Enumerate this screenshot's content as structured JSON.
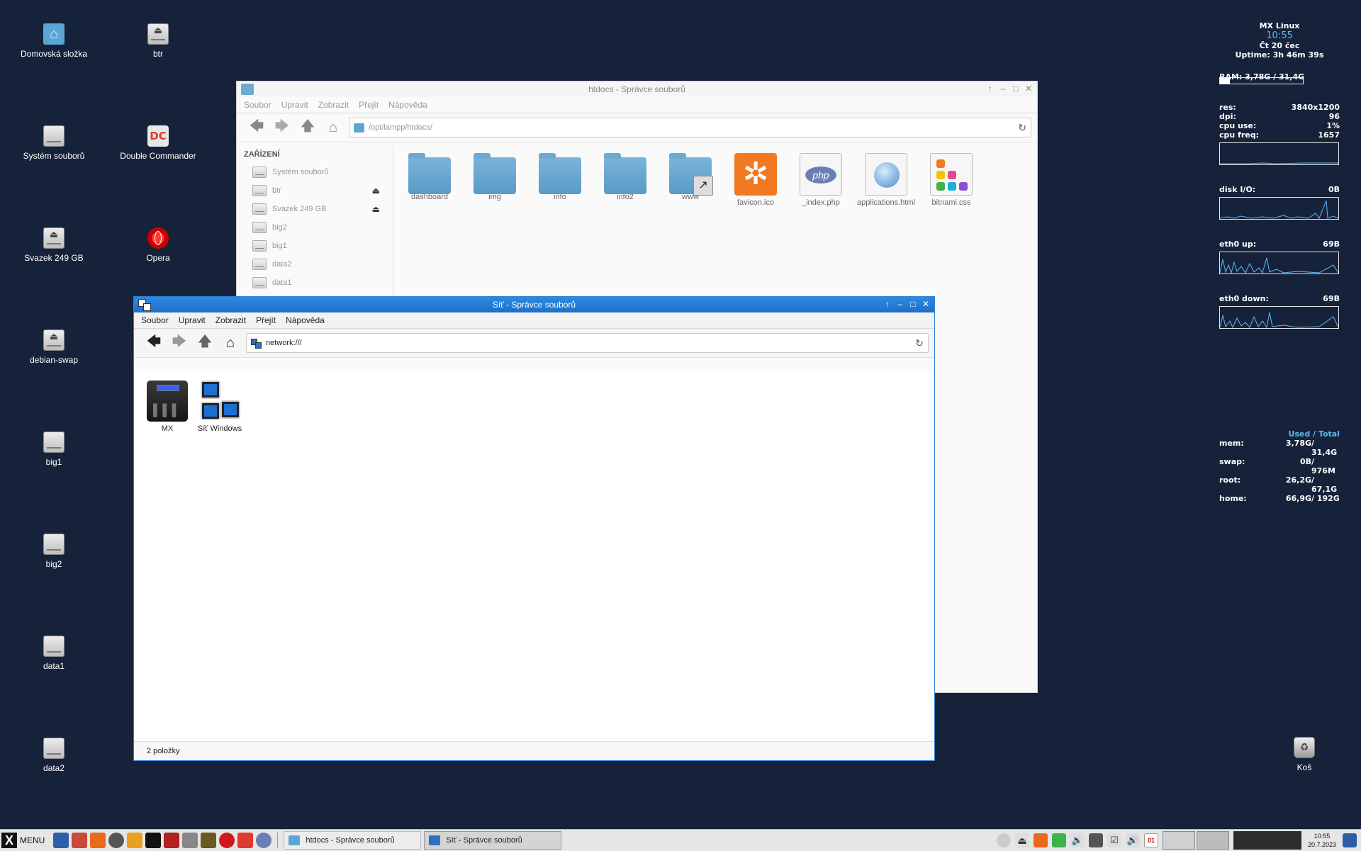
{
  "desktop": {
    "icons": [
      {
        "label": "Domovská složka",
        "kind": "home"
      },
      {
        "label": "btr",
        "kind": "eject"
      },
      {
        "label": "Systém souborů",
        "kind": "drive"
      },
      {
        "label": "Double Commander",
        "kind": "dc"
      },
      {
        "label": "Svazek 249 GB",
        "kind": "eject"
      },
      {
        "label": "Opera",
        "kind": "opera"
      },
      {
        "label": "debian-swap",
        "kind": "drive"
      },
      {
        "label": "big1",
        "kind": "drive"
      },
      {
        "label": "big2",
        "kind": "drive"
      },
      {
        "label": "data1",
        "kind": "drive"
      },
      {
        "label": "data2",
        "kind": "drive"
      },
      {
        "label": "Koš",
        "kind": "trash"
      }
    ]
  },
  "conky": {
    "host": "MX Linux",
    "time": "10:55",
    "date": "Čt 20 čec",
    "uptime": "Uptime: 3h 46m 39s",
    "ram_line": "RAM: 3,78G / 31,4G",
    "ram_fraction": 0.12,
    "stats": [
      {
        "k": "res:",
        "v": "3840x1200"
      },
      {
        "k": "dpi:",
        "v": "96"
      },
      {
        "k": "cpu use:",
        "v": "1%"
      },
      {
        "k": "cpu freq:",
        "v": "1657"
      }
    ],
    "disk": {
      "k": "disk I/O:",
      "v": "0B"
    },
    "eth_up": {
      "k": "eth0 up:",
      "v": "69B"
    },
    "eth_down": {
      "k": "eth0 down:",
      "v": "69B"
    },
    "mem_header": "Used / Total",
    "mem": [
      {
        "k": "mem:",
        "used": "3,78G",
        "total": "/ 31,4G"
      },
      {
        "k": "swap:",
        "used": "0B",
        "total": "/ 976M"
      },
      {
        "k": "root:",
        "used": "26,2G",
        "total": "/ 67,1G"
      },
      {
        "k": "home:",
        "used": "66,9G",
        "total": "/ 192G"
      }
    ]
  },
  "window_htdocs": {
    "title": "htdocs - Správce souborů",
    "menu": [
      "Soubor",
      "Upravit",
      "Zobrazit",
      "Přejít",
      "Nápověda"
    ],
    "path": "/opt/lampp/htdocs/",
    "sidebar_header": "ZAŘÍZENÍ",
    "devices": [
      {
        "label": "Systém souborů",
        "eject": false
      },
      {
        "label": "btr",
        "eject": true
      },
      {
        "label": "Svazek 249 GB",
        "eject": true
      },
      {
        "label": "big2",
        "eject": false
      },
      {
        "label": "big1",
        "eject": false
      },
      {
        "label": "data2",
        "eject": false
      },
      {
        "label": "data1",
        "eject": false
      }
    ],
    "files": [
      {
        "label": "dashboard",
        "kind": "folder"
      },
      {
        "label": "img",
        "kind": "folder"
      },
      {
        "label": "info",
        "kind": "folder"
      },
      {
        "label": "info2",
        "kind": "folder"
      },
      {
        "label": "www",
        "kind": "folder-link"
      },
      {
        "label": "favicon.ico",
        "kind": "xampp"
      },
      {
        "label": "_index.php",
        "kind": "php"
      },
      {
        "label": "applications.html",
        "kind": "html"
      },
      {
        "label": "bitnami.css",
        "kind": "css"
      }
    ]
  },
  "window_network": {
    "title": "Síť - Správce souborů",
    "menu": [
      "Soubor",
      "Upravit",
      "Zobrazit",
      "Přejít",
      "Nápověda"
    ],
    "path": "network:///",
    "items": [
      {
        "label": "MX",
        "kind": "nas"
      },
      {
        "label": "Síť Windows",
        "kind": "winnet"
      }
    ],
    "status": "2 položky"
  },
  "taskbar": {
    "menu_label": "MENU",
    "tasks": [
      {
        "label": "htdocs - Správce souborů",
        "current": false
      },
      {
        "label": "Síť - Správce souborů",
        "current": true
      }
    ],
    "clock_time": "10:55",
    "clock_date": "20.7.2023",
    "calendar_day": "01",
    "colors": {
      "accent": "#1d6fc7",
      "desktop": "#16223a",
      "conky_blue": "#5fb9f3"
    }
  }
}
